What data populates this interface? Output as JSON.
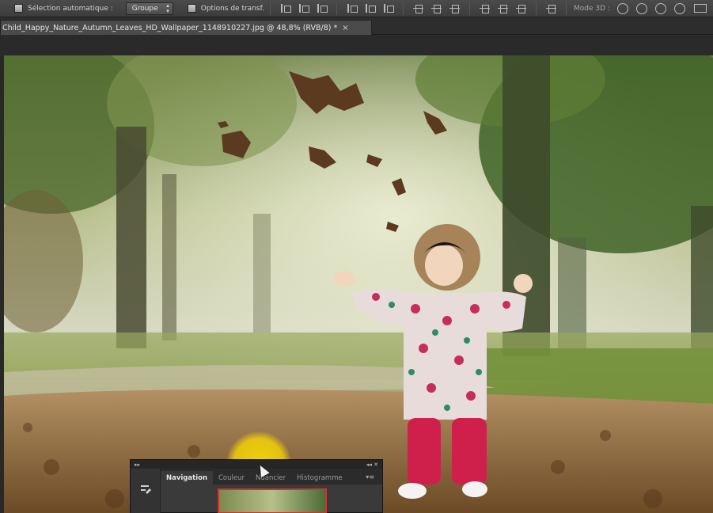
{
  "options_bar": {
    "auto_select_label": "Sélection automatique :",
    "auto_select_value": "Groupe",
    "transform_controls_label": "Options de transf.",
    "mode_3d_label": "Mode 3D :"
  },
  "document_tab": {
    "title": "Child_Happy_Nature_Autumn_Leaves_HD_Wallpaper_1148910227.jpg @ 48,8% (RVB/8) *",
    "close_glyph": "×"
  },
  "navigator_panel": {
    "header_left": "▸▸",
    "header_right": "◂◂ ✕",
    "tabs": [
      "Navigation",
      "Couleur",
      "Nuancier",
      "Histogramme"
    ],
    "active_tab": "Navigation",
    "menu_glyph": "▾≡"
  },
  "photo": {
    "subject": "child in floral hooded coat among falling autumn leaves",
    "palette": {
      "sky": "#d9dcc0",
      "foliage": "#6f8a3c",
      "ground": "#8a6a3f",
      "coat": "#e3d8d6",
      "pants": "#d0204a"
    }
  },
  "icons": [
    "checkbox-icon",
    "align-icon",
    "distribute-icon",
    "3d-orbit-icon",
    "3d-roll-icon",
    "3d-pan-icon",
    "3d-slide-icon",
    "video-icon"
  ]
}
